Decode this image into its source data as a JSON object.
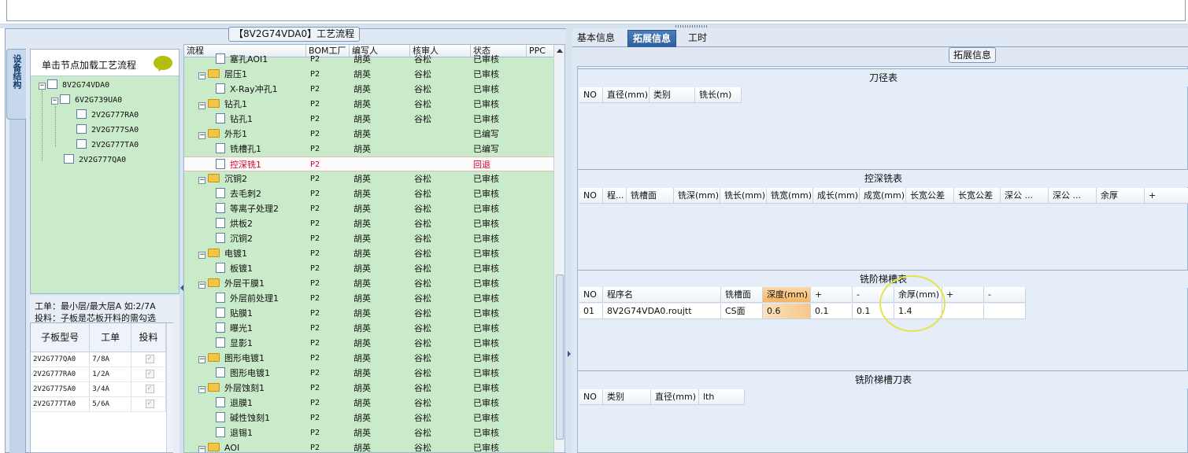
{
  "left": {
    "vtab_label": "设备结构",
    "struct_hint": "单击节点加载工艺流程",
    "tree": [
      "8V2G74VDA0",
      "6V2G739UA0",
      "2V2G777RA0",
      "2V2G777SA0",
      "2V2G777TA0",
      "2V2G777QA0"
    ],
    "info_line1": "工单：最小层/最大层A 如:2/7A",
    "info_line2": "投料：子板是芯板开料的需勾选",
    "sub_headers": [
      "子板型号",
      "工单",
      "投料"
    ],
    "sub_rows": [
      {
        "model": "2V2G777QA0",
        "order": "7/8A",
        "check": "✓"
      },
      {
        "model": "2V2G777RA0",
        "order": "1/2A",
        "check": "✓"
      },
      {
        "model": "2V2G777SA0",
        "order": "3/4A",
        "check": "✓"
      },
      {
        "model": "2V2G777TA0",
        "order": "5/6A",
        "check": "✓"
      }
    ]
  },
  "process": {
    "title": "【8V2G74VDA0】工艺流程",
    "headers": [
      "流程",
      "BOM工厂",
      "编写人",
      "核审人",
      "状态",
      "PPC"
    ],
    "rows": [
      {
        "name": "塞孔AOI1",
        "bom": "P2",
        "writer": "胡英",
        "reviewer": "谷松",
        "status": "已审核",
        "kind": "child"
      },
      {
        "name": "层压1",
        "bom": "P2",
        "writer": "胡英",
        "reviewer": "谷松",
        "status": "已审核",
        "kind": "folder"
      },
      {
        "name": "X-Ray冲孔1",
        "bom": "P2",
        "writer": "胡英",
        "reviewer": "谷松",
        "status": "已审核",
        "kind": "child"
      },
      {
        "name": "钻孔1",
        "bom": "P2",
        "writer": "胡英",
        "reviewer": "谷松",
        "status": "已审核",
        "kind": "folder"
      },
      {
        "name": "钻孔1",
        "bom": "P2",
        "writer": "胡英",
        "reviewer": "谷松",
        "status": "已审核",
        "kind": "child"
      },
      {
        "name": "外形1",
        "bom": "P2",
        "writer": "胡英",
        "reviewer": "",
        "status": "已编写",
        "kind": "folder"
      },
      {
        "name": "铣槽孔1",
        "bom": "P2",
        "writer": "胡英",
        "reviewer": "",
        "status": "已编写",
        "kind": "child"
      },
      {
        "name": "控深铣1",
        "bom": "P2",
        "writer": "",
        "reviewer": "",
        "status": "回退",
        "kind": "child",
        "selected": true
      },
      {
        "name": "沉铜2",
        "bom": "P2",
        "writer": "胡英",
        "reviewer": "谷松",
        "status": "已审核",
        "kind": "folder"
      },
      {
        "name": "去毛刺2",
        "bom": "P2",
        "writer": "胡英",
        "reviewer": "谷松",
        "status": "已审核",
        "kind": "child"
      },
      {
        "name": "等离子处理2",
        "bom": "P2",
        "writer": "胡英",
        "reviewer": "谷松",
        "status": "已审核",
        "kind": "child"
      },
      {
        "name": "烘板2",
        "bom": "P2",
        "writer": "胡英",
        "reviewer": "谷松",
        "status": "已审核",
        "kind": "child"
      },
      {
        "name": "沉铜2",
        "bom": "P2",
        "writer": "胡英",
        "reviewer": "谷松",
        "status": "已审核",
        "kind": "child"
      },
      {
        "name": "电镀1",
        "bom": "P2",
        "writer": "胡英",
        "reviewer": "谷松",
        "status": "已审核",
        "kind": "folder"
      },
      {
        "name": "板镀1",
        "bom": "P2",
        "writer": "胡英",
        "reviewer": "谷松",
        "status": "已审核",
        "kind": "child"
      },
      {
        "name": "外层干膜1",
        "bom": "P2",
        "writer": "胡英",
        "reviewer": "谷松",
        "status": "已审核",
        "kind": "folder"
      },
      {
        "name": "外层前处理1",
        "bom": "P2",
        "writer": "胡英",
        "reviewer": "谷松",
        "status": "已审核",
        "kind": "child"
      },
      {
        "name": "贴膜1",
        "bom": "P2",
        "writer": "胡英",
        "reviewer": "谷松",
        "status": "已审核",
        "kind": "child"
      },
      {
        "name": "曝光1",
        "bom": "P2",
        "writer": "胡英",
        "reviewer": "谷松",
        "status": "已审核",
        "kind": "child"
      },
      {
        "name": "显影1",
        "bom": "P2",
        "writer": "胡英",
        "reviewer": "谷松",
        "status": "已审核",
        "kind": "child"
      },
      {
        "name": "图形电镀1",
        "bom": "P2",
        "writer": "胡英",
        "reviewer": "谷松",
        "status": "已审核",
        "kind": "folder"
      },
      {
        "name": "图形电镀1",
        "bom": "P2",
        "writer": "胡英",
        "reviewer": "谷松",
        "status": "已审核",
        "kind": "child"
      },
      {
        "name": "外层蚀刻1",
        "bom": "P2",
        "writer": "胡英",
        "reviewer": "谷松",
        "status": "已审核",
        "kind": "folder"
      },
      {
        "name": "退膜1",
        "bom": "P2",
        "writer": "胡英",
        "reviewer": "谷松",
        "status": "已审核",
        "kind": "child"
      },
      {
        "name": "碱性蚀刻1",
        "bom": "P2",
        "writer": "胡英",
        "reviewer": "谷松",
        "status": "已审核",
        "kind": "child"
      },
      {
        "name": "退锡1",
        "bom": "P2",
        "writer": "胡英",
        "reviewer": "谷松",
        "status": "已审核",
        "kind": "child"
      },
      {
        "name": "AOI",
        "bom": "P2",
        "writer": "胡英",
        "reviewer": "谷松",
        "status": "已审核",
        "kind": "folder"
      }
    ]
  },
  "right": {
    "tabs": [
      "基本信息",
      "拓展信息",
      "工时"
    ],
    "active_tab": "拓展信息",
    "ext_title": "拓展信息",
    "cutter_title": "刀径表",
    "cutter_headers": [
      "NO",
      "直径(mm)",
      "类别",
      "铣长(m)"
    ],
    "depth_title": "控深铣表",
    "depth_headers": [
      "NO",
      "程...",
      "铣槽面",
      "铣深(mm)",
      "铣长(mm)",
      "铣宽(mm)",
      "成长(mm)",
      "成宽(mm)",
      "长宽公差",
      "长宽公差",
      "深公 ...",
      "深公 ...",
      "余厚",
      "+"
    ],
    "step_title": "铣阶梯槽表",
    "step_headers": [
      "NO",
      "程序名",
      "铣槽面",
      "深度(mm)",
      "+",
      "-",
      "余厚(mm)",
      "+",
      "-"
    ],
    "step_row": [
      "01",
      "8V2G74VDA0.roujtt",
      "CS面",
      "0.6",
      "0.1",
      "0.1",
      "1.4",
      "",
      ""
    ],
    "step_cutter_title": "铣阶梯槽刀表",
    "step_cutter_headers": [
      "NO",
      "类别",
      "直径(mm)",
      "lth"
    ]
  }
}
